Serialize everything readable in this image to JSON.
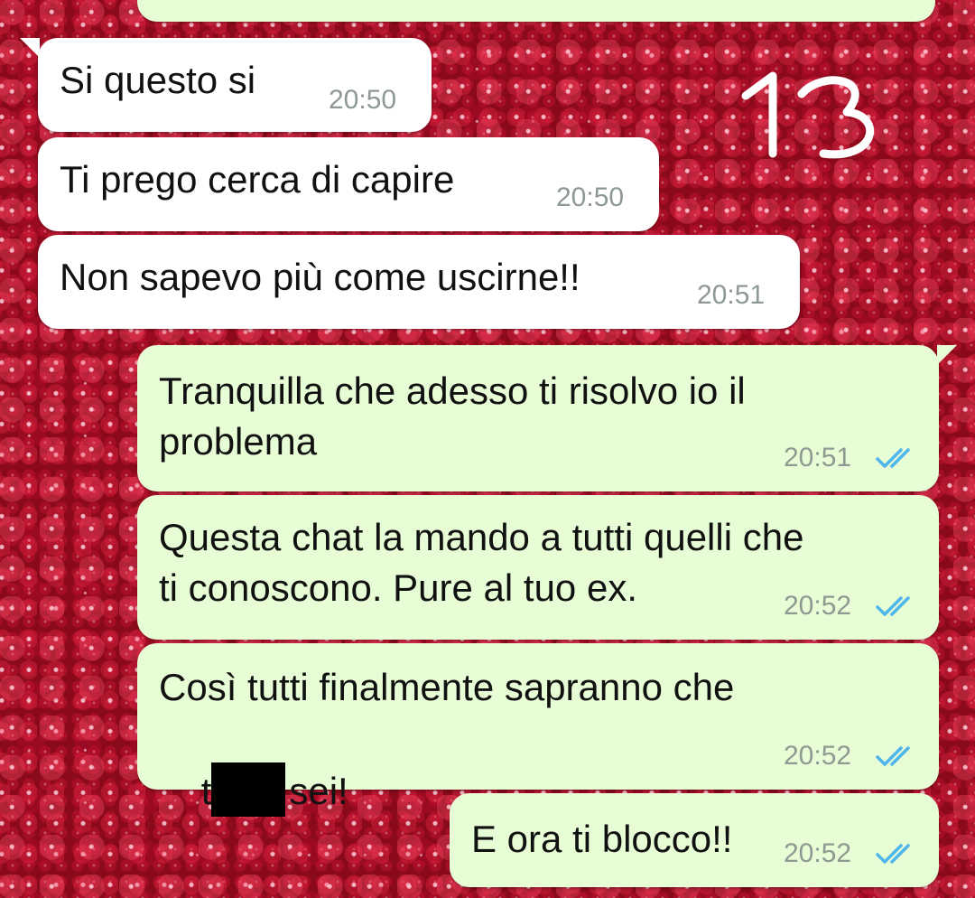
{
  "messages": [
    {
      "id": "m0",
      "direction": "outgoing",
      "text": "",
      "time": "",
      "status": "read"
    },
    {
      "id": "m1",
      "direction": "incoming",
      "text": "Si questo si",
      "time": "20:50"
    },
    {
      "id": "m2",
      "direction": "incoming",
      "text": "Ti prego cerca di capire",
      "time": "20:50"
    },
    {
      "id": "m3",
      "direction": "incoming",
      "text": "Non sapevo più come uscirne!!",
      "time": "20:51"
    },
    {
      "id": "m4",
      "direction": "outgoing",
      "line1": "Tranquilla che adesso ti risolvo io il",
      "line2": "problema",
      "time": "20:51",
      "status": "read"
    },
    {
      "id": "m5",
      "direction": "outgoing",
      "line1": "Questa chat la mando a tutti quelli che",
      "line2": "ti conoscono. Pure al tuo ex.",
      "time": "20:52",
      "status": "read"
    },
    {
      "id": "m6",
      "direction": "outgoing",
      "line1": "Così tutti finalmente sapranno che",
      "line2_prefix": "t",
      "line2_suffix": "sei!",
      "time": "20:52",
      "status": "read",
      "redacted": true
    },
    {
      "id": "m7",
      "direction": "outgoing",
      "text": "E ora ti blocco!!",
      "time": "20:52",
      "status": "read"
    }
  ],
  "annotation": {
    "text": "13",
    "color": "#ffffff"
  },
  "colors": {
    "incoming_bubble": "#ffffff",
    "outgoing_bubble": "#e7fdd5",
    "read_ticks": "#4fb6ec",
    "timestamp": "#8e9a91"
  },
  "icons": {
    "read_receipt": "double-check-icon"
  }
}
